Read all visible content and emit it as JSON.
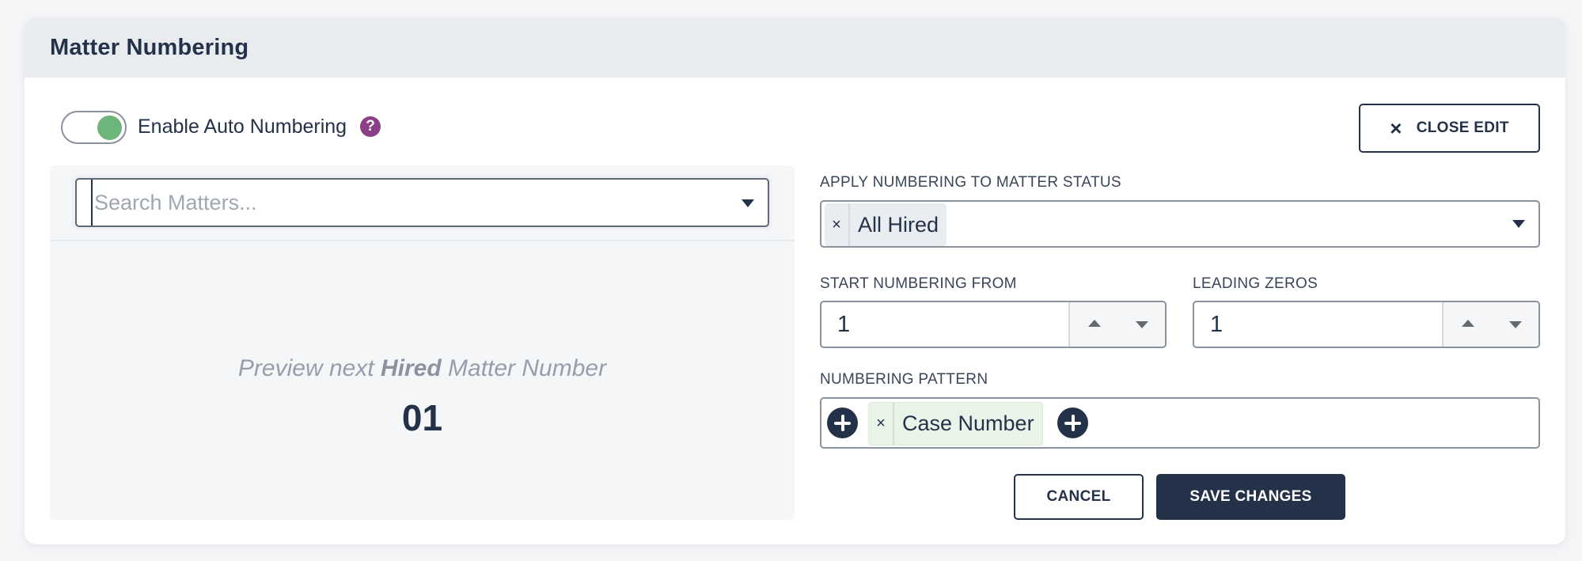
{
  "header": {
    "title": "Matter Numbering"
  },
  "auto_numbering": {
    "label": "Enable Auto Numbering",
    "enabled": true,
    "help_icon": "question-circle-icon",
    "help_glyph": "?",
    "toggle_color": "#6db57a"
  },
  "close_edit": {
    "icon": "close-icon",
    "glyph": "×",
    "label": "CLOSE EDIT"
  },
  "preview": {
    "search": {
      "placeholder": "Search Matters...",
      "value": "",
      "icon": "caret-down-icon"
    },
    "label_prefix": "Preview next",
    "label_status": "Hired",
    "label_suffix": "Matter Number",
    "next_number": "01"
  },
  "form": {
    "status": {
      "label": "APPLY NUMBERING TO MATTER STATUS",
      "selected": [
        {
          "label": "All Hired",
          "remove_glyph": "×"
        }
      ],
      "icon": "caret-down-icon"
    },
    "start_from": {
      "label": "START NUMBERING FROM",
      "value": "1"
    },
    "leading_zeros": {
      "label": "LEADING ZEROS",
      "value": "1"
    },
    "pattern": {
      "label": "NUMBERING PATTERN",
      "tokens": [
        {
          "label": "Case Number",
          "remove_glyph": "×"
        }
      ],
      "add_icon": "plus-circle-icon"
    }
  },
  "actions": {
    "cancel_label": "CANCEL",
    "save_label": "SAVE CHANGES"
  },
  "colors": {
    "primary": "#243249",
    "help_icon": "#8b3f86",
    "toggle_on": "#6db57a",
    "pattern_chip": "#e8f4e8",
    "status_chip": "#e9ecf0"
  }
}
